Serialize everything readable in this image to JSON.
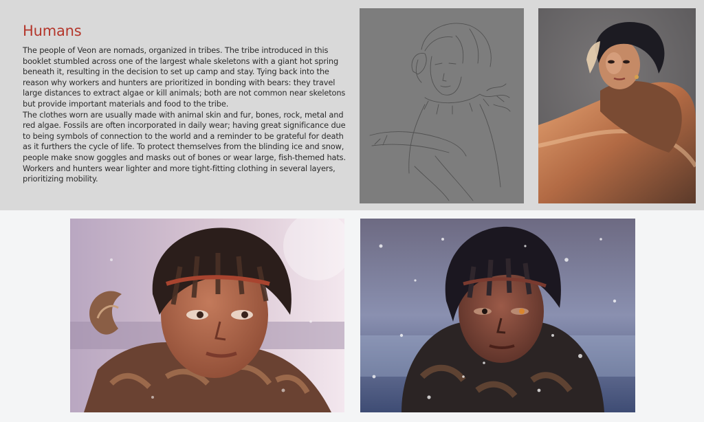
{
  "page": {
    "title": "Humans",
    "paragraphs": [
      "The people of Veon are nomads, organized in tribes. The tribe introduced in this booklet stumbled across one of the largest whale skeletons with a giant hot spring beneath it, resulting in the decision to set up camp and stay. Tying back into the reason why workers and hunters are prioritized in bonding with bears: they travel large distances to extract algae or kill animals; both are not common near skeletons but provide important materials and food to the tribe.",
      "The clothes worn are usually made with animal skin and fur, bones, rock, metal and red algae. Fossils are often incorporated in daily wear; having great significance due to being symbols of connection to the world and a reminder to be grateful for death as it furthers the cycle of life. To protect themselves from the blinding ice and snow, people make snow goggles and masks out of bones or wear large, fish-themed hats. Workers and hunters wear lighter and more tight-fitting clothing in several layers, prioritizing mobility."
    ]
  },
  "colors": {
    "heading": "#b4362b",
    "top_band": "#d9d9d9",
    "page_background": "#f4f5f6"
  },
  "images": [
    {
      "id": "pencil-sketch",
      "kind": "line-sketch-portrait"
    },
    {
      "id": "painted-study",
      "kind": "painted-portrait-fur-coat"
    },
    {
      "id": "render-day",
      "kind": "3d-render-portrait-pink-sky"
    },
    {
      "id": "render-snow",
      "kind": "3d-render-portrait-snowfall"
    }
  ]
}
